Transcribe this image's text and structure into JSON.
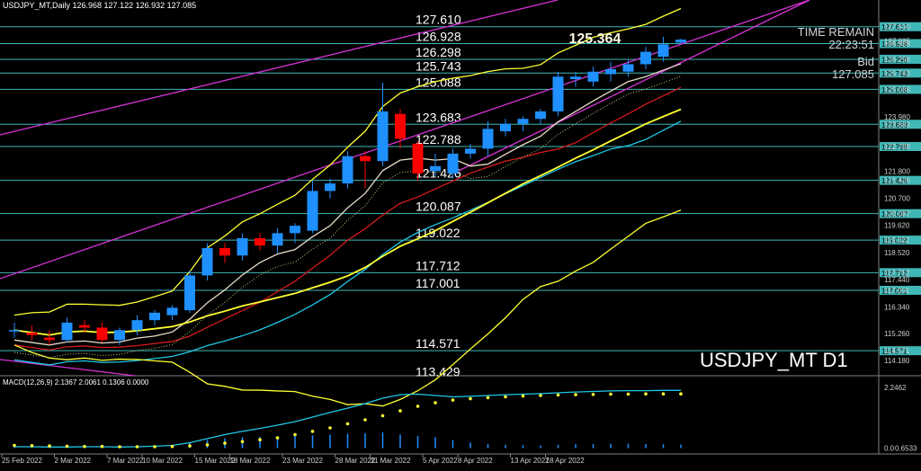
{
  "header": {
    "info": "USDJPY_MT,Daily  126.968 127.122 126.932 127.085"
  },
  "macd_header": "MACD(12,26,9) 2.1367 2.0061 0.1306 0.0000",
  "panel": {
    "time_remain_label": "TIME REMAIN",
    "time_remain_value": "22:23:51",
    "bid_label": "Bid",
    "bid_value": "127.085"
  },
  "symbol_label": "USDJPY_MT D1",
  "peak_label": "125.364",
  "colors": {
    "background": "#000000",
    "bull": "#1e90ff",
    "bear": "#ff0000",
    "level_line": "#3fb7b7",
    "channel": "#d633d6",
    "bollinger": "#ffff33",
    "ma_red": "#d41b1b",
    "ma_cyan": "#1ec8e8",
    "ma_gold": "#d4a017",
    "ma_white": "#e8dcc8"
  },
  "chart_data": {
    "type": "candlestick",
    "symbol": "USDJPY_MT",
    "timeframe": "D1",
    "ylim": [
      113.6,
      128.25
    ],
    "x_tick_labels": [
      "25 Feb 2022",
      "2 Mar 2022",
      "7 Mar 2022",
      "10 Mar 2022",
      "15 Mar 2022",
      "18 Mar 2022",
      "23 Mar 2022",
      "28 Mar 2022",
      "31 Mar 2022",
      "5 Apr 2022",
      "8 Apr 2022",
      "13 Apr 2022",
      "18 Apr 2022"
    ],
    "y_tick_labels": [
      "127.610",
      "127.035",
      "126.928",
      "126.298",
      "125.743",
      "125.088",
      "123.980",
      "123.683",
      "122.788",
      "121.800",
      "121.426",
      "120.700",
      "120.087",
      "119.620",
      "119.022",
      "118.520",
      "117.712",
      "117.440",
      "117.001",
      "116.340",
      "115.260",
      "114.571",
      "114.180"
    ],
    "levels": [
      {
        "value": 127.61,
        "label": "127.610"
      },
      {
        "value": 126.928,
        "label": "126.928"
      },
      {
        "value": 126.298,
        "label": "126.298"
      },
      {
        "value": 125.743,
        "label": "125.743"
      },
      {
        "value": 125.088,
        "label": "125.088"
      },
      {
        "value": 123.683,
        "label": "123.683"
      },
      {
        "value": 122.788,
        "label": "122.788"
      },
      {
        "value": 121.426,
        "label": "121.426"
      },
      {
        "value": 120.087,
        "label": "120.087"
      },
      {
        "value": 119.022,
        "label": "119.022"
      },
      {
        "value": 117.712,
        "label": "117.712"
      },
      {
        "value": 117.001,
        "label": "117.001"
      },
      {
        "value": 114.571,
        "label": "114.571"
      },
      {
        "value": 113.429,
        "label": "113.429"
      }
    ],
    "candles": [
      {
        "o": 115.4,
        "h": 115.7,
        "l": 115.1,
        "c": 115.4
      },
      {
        "o": 115.3,
        "h": 115.6,
        "l": 115.0,
        "c": 115.2
      },
      {
        "o": 115.1,
        "h": 115.4,
        "l": 114.8,
        "c": 115.0
      },
      {
        "o": 115.0,
        "h": 115.9,
        "l": 114.9,
        "c": 115.7
      },
      {
        "o": 115.6,
        "h": 115.8,
        "l": 115.3,
        "c": 115.5
      },
      {
        "o": 115.5,
        "h": 115.7,
        "l": 114.9,
        "c": 115.0
      },
      {
        "o": 115.0,
        "h": 115.5,
        "l": 114.8,
        "c": 115.4
      },
      {
        "o": 115.4,
        "h": 116.0,
        "l": 115.2,
        "c": 115.8
      },
      {
        "o": 115.8,
        "h": 116.2,
        "l": 115.6,
        "c": 116.1
      },
      {
        "o": 116.0,
        "h": 116.4,
        "l": 115.8,
        "c": 116.3
      },
      {
        "o": 116.2,
        "h": 117.8,
        "l": 116.1,
        "c": 117.6
      },
      {
        "o": 117.6,
        "h": 118.9,
        "l": 117.4,
        "c": 118.7
      },
      {
        "o": 118.7,
        "h": 118.9,
        "l": 118.1,
        "c": 118.4
      },
      {
        "o": 118.4,
        "h": 119.3,
        "l": 118.2,
        "c": 119.1
      },
      {
        "o": 119.1,
        "h": 119.3,
        "l": 118.6,
        "c": 118.8
      },
      {
        "o": 118.8,
        "h": 119.5,
        "l": 118.5,
        "c": 119.3
      },
      {
        "o": 119.3,
        "h": 119.7,
        "l": 118.9,
        "c": 119.6
      },
      {
        "o": 119.4,
        "h": 121.4,
        "l": 119.3,
        "c": 121.0
      },
      {
        "o": 121.0,
        "h": 121.5,
        "l": 120.7,
        "c": 121.3
      },
      {
        "o": 121.3,
        "h": 122.6,
        "l": 121.1,
        "c": 122.4
      },
      {
        "o": 122.4,
        "h": 122.6,
        "l": 121.1,
        "c": 122.2
      },
      {
        "o": 122.2,
        "h": 125.36,
        "l": 122.0,
        "c": 124.2
      },
      {
        "o": 124.1,
        "h": 124.3,
        "l": 122.7,
        "c": 123.1
      },
      {
        "o": 122.9,
        "h": 123.0,
        "l": 121.4,
        "c": 121.7
      },
      {
        "o": 121.8,
        "h": 122.5,
        "l": 121.6,
        "c": 122.0
      },
      {
        "o": 121.7,
        "h": 122.7,
        "l": 121.5,
        "c": 122.5
      },
      {
        "o": 122.5,
        "h": 122.9,
        "l": 122.3,
        "c": 122.7
      },
      {
        "o": 122.7,
        "h": 123.8,
        "l": 122.4,
        "c": 123.5
      },
      {
        "o": 123.4,
        "h": 123.9,
        "l": 123.2,
        "c": 123.7
      },
      {
        "o": 123.7,
        "h": 124.0,
        "l": 123.4,
        "c": 123.9
      },
      {
        "o": 123.9,
        "h": 124.3,
        "l": 123.7,
        "c": 124.2
      },
      {
        "o": 124.2,
        "h": 125.8,
        "l": 124.0,
        "c": 125.6
      },
      {
        "o": 125.5,
        "h": 125.8,
        "l": 125.2,
        "c": 125.6
      },
      {
        "o": 125.4,
        "h": 126.0,
        "l": 125.2,
        "c": 125.8
      },
      {
        "o": 125.7,
        "h": 126.2,
        "l": 125.4,
        "c": 125.9
      },
      {
        "o": 125.8,
        "h": 126.3,
        "l": 125.6,
        "c": 126.1
      },
      {
        "o": 126.1,
        "h": 126.8,
        "l": 125.9,
        "c": 126.6
      },
      {
        "o": 126.4,
        "h": 127.2,
        "l": 126.2,
        "c": 126.9
      },
      {
        "o": 126.97,
        "h": 127.12,
        "l": 126.93,
        "c": 127.09
      }
    ],
    "macd": {
      "fast": 12,
      "slow": 26,
      "signal": 9,
      "values": [
        2.1367,
        2.0061,
        0.1306,
        0.0
      ],
      "y_tick_labels": [
        "2.2462",
        "0.0",
        "0.6533"
      ],
      "ylim": [
        -0.05,
        2.35
      ],
      "histogram": [
        0.1,
        0.05,
        0.04,
        0.05,
        0.06,
        0.05,
        0.02,
        0.05,
        0.08,
        0.1,
        0.2,
        0.3,
        0.36,
        0.4,
        0.42,
        0.44,
        0.45,
        0.47,
        0.5,
        0.53,
        0.55,
        0.58,
        0.5,
        0.45,
        0.4,
        0.3,
        0.2,
        0.15,
        0.12,
        0.11,
        0.1,
        0.12,
        0.14,
        0.15,
        0.16,
        0.16,
        0.15,
        0.14,
        0.13
      ],
      "main": [
        0.05,
        0.05,
        0.04,
        0.04,
        0.05,
        0.05,
        0.04,
        0.05,
        0.07,
        0.1,
        0.2,
        0.35,
        0.5,
        0.62,
        0.73,
        0.85,
        0.98,
        1.15,
        1.32,
        1.48,
        1.65,
        1.85,
        1.98,
        2.0,
        1.95,
        1.9,
        1.92,
        1.95,
        1.98,
        2.0,
        2.02,
        2.05,
        2.08,
        2.1,
        2.12,
        2.13,
        2.13,
        2.14,
        2.14
      ],
      "signal_line": [
        0.1,
        0.09,
        0.08,
        0.07,
        0.06,
        0.06,
        0.05,
        0.05,
        0.05,
        0.06,
        0.08,
        0.12,
        0.18,
        0.24,
        0.31,
        0.38,
        0.5,
        0.62,
        0.75,
        0.9,
        1.05,
        1.2,
        1.38,
        1.55,
        1.68,
        1.78,
        1.83,
        1.87,
        1.9,
        1.93,
        1.95,
        1.97,
        1.98,
        1.99,
        2.0,
        2.0,
        2.01,
        2.01,
        2.01
      ]
    }
  }
}
